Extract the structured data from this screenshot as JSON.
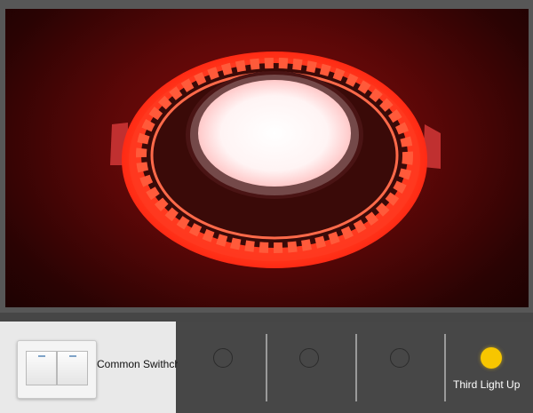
{
  "switch": {
    "label": "Common Swithch"
  },
  "toggles": {
    "items": [
      {
        "state": "off"
      },
      {
        "state": "off"
      },
      {
        "state": "off"
      },
      {
        "state": "on",
        "label": "Third Light Up"
      }
    ]
  },
  "colors": {
    "indicator_on": "#f7c600",
    "light_glow": "#ff2a1a",
    "background_red": "#5a0707"
  }
}
